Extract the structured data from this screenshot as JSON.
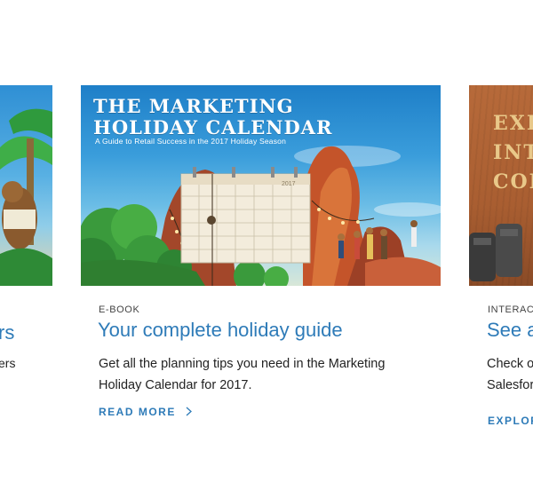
{
  "cards": {
    "left": {
      "title_fragment": "rs",
      "desc_fragment": "ers"
    },
    "center": {
      "hero_title_line1": "THE MARKETING",
      "hero_title_line2": "HOLIDAY CALENDAR",
      "hero_subtitle": "A Guide to Retail Success in the 2017 Holiday Season",
      "calendar_year": "2017",
      "category": "E-BOOK",
      "headline": "Your complete holiday guide",
      "description": "Get all the planning tips you need in the Marketing Holiday Calendar for 2017.",
      "cta": "READ MORE"
    },
    "right": {
      "hero_line1": "EXP",
      "hero_line2": "INTE",
      "hero_line3": "CON",
      "category": "INTERACT",
      "headline": "See a",
      "desc_line1": "Check o",
      "desc_line2": "Salesfor",
      "cta": "EXPLOR"
    }
  },
  "icons": {
    "cta_chevron": "chevron-right-icon"
  },
  "colors": {
    "link_blue": "#2e7bb8",
    "body_text": "#222222",
    "meta_text": "#444444"
  }
}
